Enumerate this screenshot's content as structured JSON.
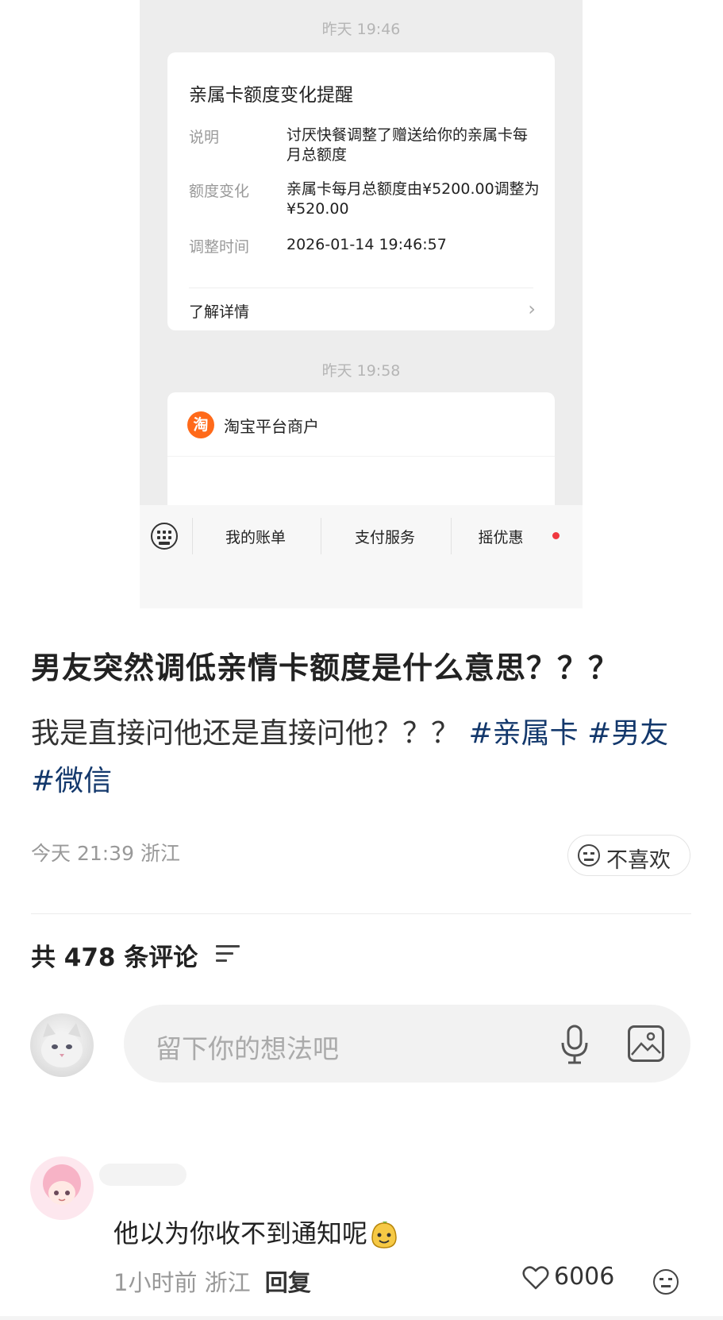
{
  "screenshot": {
    "timestamp1": "昨天 19:46",
    "card": {
      "title": "亲属卡额度变化提醒",
      "rows": [
        {
          "label": "说明",
          "value": "讨厌快餐调整了赠送给你的亲属卡每月总额度"
        },
        {
          "label": "额度变化",
          "value": "亲属卡每月总额度由¥5200.00调整为¥520.00"
        },
        {
          "label": "调整时间",
          "value": "2026-01-14 19:46:57"
        }
      ],
      "link": "了解详情"
    },
    "timestamp2": "昨天 19:58",
    "merchant": {
      "icon_text": "淘",
      "name": "淘宝平台商户"
    },
    "menu": {
      "item1": "我的账单",
      "item2": "支付服务",
      "item3": "摇优惠"
    }
  },
  "post": {
    "title": "男友突然调低亲情卡额度是什么意思？？？",
    "body": "我是直接问他还是直接问他？？？",
    "tags": [
      "#亲属卡",
      "#男友",
      "#微信"
    ],
    "time": "今天 21:39",
    "location": "浙江",
    "dislike_label": "不喜欢"
  },
  "comments_header": {
    "label": "共 478 条评论"
  },
  "comment_input": {
    "placeholder": "留下你的想法吧"
  },
  "comment": {
    "text": "他以为你收不到通知呢",
    "time": "1小时前",
    "location": "浙江",
    "reply_label": "回复",
    "likes": "6006"
  },
  "colors": {
    "tag": "#13386c",
    "accent_red": "#f0383f",
    "taobao_orange": "#ff6a1a"
  }
}
